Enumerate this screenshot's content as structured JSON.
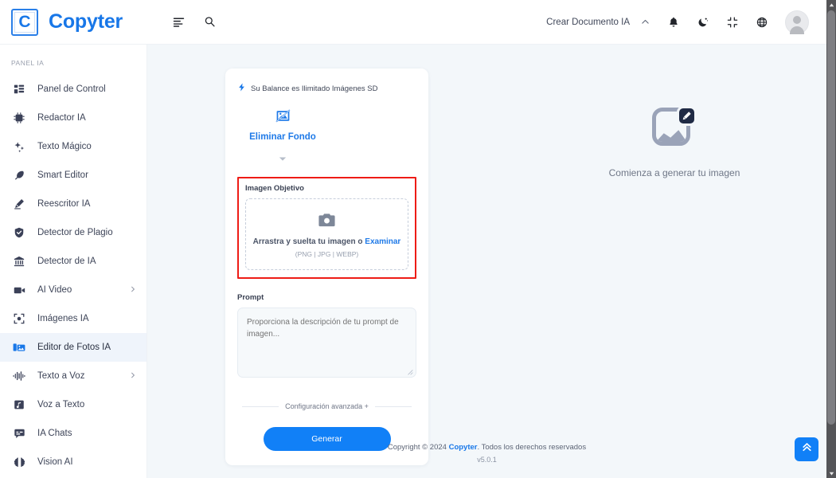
{
  "header": {
    "logo_letter": "C",
    "brand_name": "Copyter",
    "menu_icon": "list-menu-icon",
    "search_icon": "search-icon",
    "create_doc_label": "Crear Documento IA",
    "chevron_icon": "chevron-up-icon",
    "notifications_icon": "bell-icon",
    "theme_icon": "moon-icon",
    "fullscreen_icon": "compress-icon",
    "language_icon": "globe-icon",
    "avatar_alt": "user-avatar"
  },
  "sidebar": {
    "section_label": "PANEL IA",
    "items": [
      {
        "label": "Panel de Control",
        "icon": "dashboard-icon",
        "active": false,
        "has_chevron": false
      },
      {
        "label": "Redactor IA",
        "icon": "chip-icon",
        "active": false,
        "has_chevron": false
      },
      {
        "label": "Texto Mágico",
        "icon": "sparkles-icon",
        "active": false,
        "has_chevron": false
      },
      {
        "label": "Smart Editor",
        "icon": "feather-icon",
        "active": false,
        "has_chevron": false
      },
      {
        "label": "Reescritor IA",
        "icon": "pencil-icon",
        "active": false,
        "has_chevron": false
      },
      {
        "label": "Detector de Plagio",
        "icon": "shield-check-icon",
        "active": false,
        "has_chevron": false
      },
      {
        "label": "Detector de IA",
        "icon": "bank-icon",
        "active": false,
        "has_chevron": false
      },
      {
        "label": "AI Video",
        "icon": "video-camera-icon",
        "active": false,
        "has_chevron": true
      },
      {
        "label": "Imágenes IA",
        "icon": "photo-frame-icon",
        "active": false,
        "has_chevron": false
      },
      {
        "label": "Editor de Fotos IA",
        "icon": "photo-edit-icon",
        "active": true,
        "has_chevron": false
      },
      {
        "label": "Texto a Voz",
        "icon": "waveform-icon",
        "active": false,
        "has_chevron": true
      },
      {
        "label": "Voz a Texto",
        "icon": "music-note-icon",
        "active": false,
        "has_chevron": false
      },
      {
        "label": "IA Chats",
        "icon": "chat-bubble-icon",
        "active": false,
        "has_chevron": false
      },
      {
        "label": "Vision AI",
        "icon": "brain-icon",
        "active": false,
        "has_chevron": false
      }
    ]
  },
  "card": {
    "balance_icon": "bolt-icon",
    "balance_text": "Su Balance es Ilimitado Imágenes SD",
    "tool": {
      "icon": "image-slash-icon",
      "label": "Eliminar Fondo",
      "caret_icon": "chevron-down-icon"
    },
    "upload": {
      "label": "Imagen Objetivo",
      "camera_icon": "camera-icon",
      "drop_text": "Arrastra y suelta tu imagen o ",
      "browse_link": "Examinar",
      "formats": "(PNG | JPG | WEBP)",
      "highlight_color": "#ee1c16"
    },
    "prompt": {
      "label": "Prompt",
      "placeholder": "Proporciona la descripción de tu prompt de imagen...",
      "value": ""
    },
    "advanced_label": "Configuración avanzada +",
    "generate_label": "Generar"
  },
  "preview": {
    "icon": "image-edit-placeholder-icon",
    "message": "Comienza a generar tu imagen"
  },
  "footer": {
    "copyright_prefix": "Copyright © 2024 ",
    "brand": "Copyter",
    "copyright_suffix": ". Todos los derechos reservados",
    "version": "v5.0.1"
  },
  "scroll_top": {
    "icon": "double-chevron-up-icon"
  },
  "colors": {
    "accent_blue": "#1877e8",
    "button_blue": "#1180f7",
    "highlight_red": "#ee1c16",
    "canvas_bg": "#f3f7fa",
    "active_nav_bg": "#eff4fb"
  }
}
